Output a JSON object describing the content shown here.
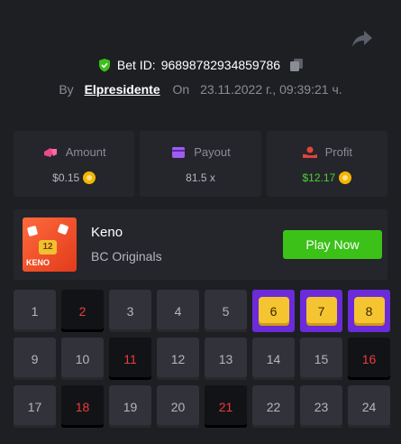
{
  "header": {
    "bet_id_label": "Bet ID:",
    "bet_id": "96898782934859786",
    "by_label": "By",
    "username": "Elpresidente",
    "on_label": "On",
    "datetime": "23.11.2022 г., 09:39:21 ч."
  },
  "stats": {
    "amount": {
      "label": "Amount",
      "value": "$0.15",
      "icon": "wallet-icon"
    },
    "payout": {
      "label": "Payout",
      "value": "81.5 x",
      "icon": "card-icon"
    },
    "profit": {
      "label": "Profit",
      "value": "$12.17",
      "icon": "profit-icon"
    }
  },
  "game": {
    "thumb_label": "KENO",
    "thumb_tile": "12",
    "name": "Keno",
    "provider": "BC Originals",
    "play_label": "Play Now"
  },
  "colors": {
    "background": "#1e1f23",
    "panel": "#25262b",
    "accent_green": "#3bc117",
    "profit_green": "#4cd137",
    "hit_purple": "#6b2bd9",
    "hit_gold": "#f4c531",
    "selected_red": "#ec3b3b"
  },
  "grid": {
    "numbers": [
      1,
      2,
      3,
      4,
      5,
      6,
      7,
      8,
      9,
      10,
      11,
      12,
      13,
      14,
      15,
      16,
      17,
      18,
      19,
      20,
      21,
      22,
      23,
      24
    ],
    "selected_misses": [
      2,
      11,
      16,
      18,
      21
    ],
    "hits": [
      6,
      7,
      8
    ]
  }
}
